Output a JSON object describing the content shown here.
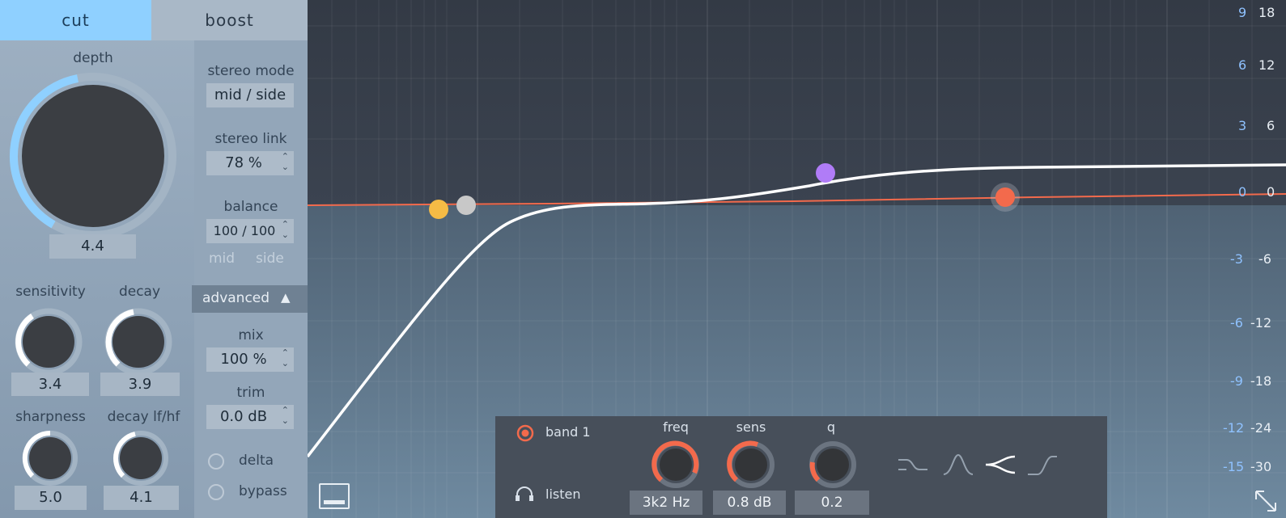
{
  "tabs": {
    "cut": "cut",
    "boost": "boost"
  },
  "depth": {
    "label": "depth",
    "value": "4.4"
  },
  "sensitivity": {
    "label": "sensitivity",
    "value": "3.4"
  },
  "decay": {
    "label": "decay",
    "value": "3.9"
  },
  "sharpness": {
    "label": "sharpness",
    "value": "5.0"
  },
  "decay_lfhf": {
    "label": "decay lf/hf",
    "value": "4.1"
  },
  "stereo_mode": {
    "label": "stereo mode",
    "value": "mid / side"
  },
  "stereo_link": {
    "label": "stereo link",
    "value": "78 %"
  },
  "balance": {
    "label": "balance",
    "value": "100 / 100",
    "mid": "mid",
    "side": "side"
  },
  "advanced": {
    "label": "advanced",
    "icon": "triangle-up-icon"
  },
  "mix": {
    "label": "mix",
    "value": "100 %"
  },
  "trim": {
    "label": "trim",
    "value": "0.0 dB"
  },
  "delta": {
    "label": "delta"
  },
  "bypass": {
    "label": "bypass"
  },
  "graph": {
    "db_scale_left": [
      "9",
      "6",
      "3",
      "0",
      "-3",
      "-6",
      "-9",
      "-12",
      "-15"
    ],
    "db_scale_right": [
      "18",
      "12",
      "6",
      "0",
      "-6",
      "-12",
      "-18",
      "-24",
      "-30"
    ],
    "node_colors": [
      "#f5bb45",
      "#c8c8c8",
      "#b07cf7",
      "#f36a4c"
    ]
  },
  "band_panel": {
    "band_label": "band 1",
    "listen_label": "listen",
    "freq": {
      "label": "freq",
      "value": "3k2 Hz"
    },
    "sens": {
      "label": "sens",
      "value": "0.8 dB"
    },
    "q": {
      "label": "q",
      "value": "0.2"
    },
    "shapes": [
      "low-shelf-icon",
      "bell-icon",
      "notch-split-icon",
      "high-shelf-icon"
    ]
  },
  "colors": {
    "accent": "#8fd0ff",
    "band_accent": "#f36a4c"
  }
}
